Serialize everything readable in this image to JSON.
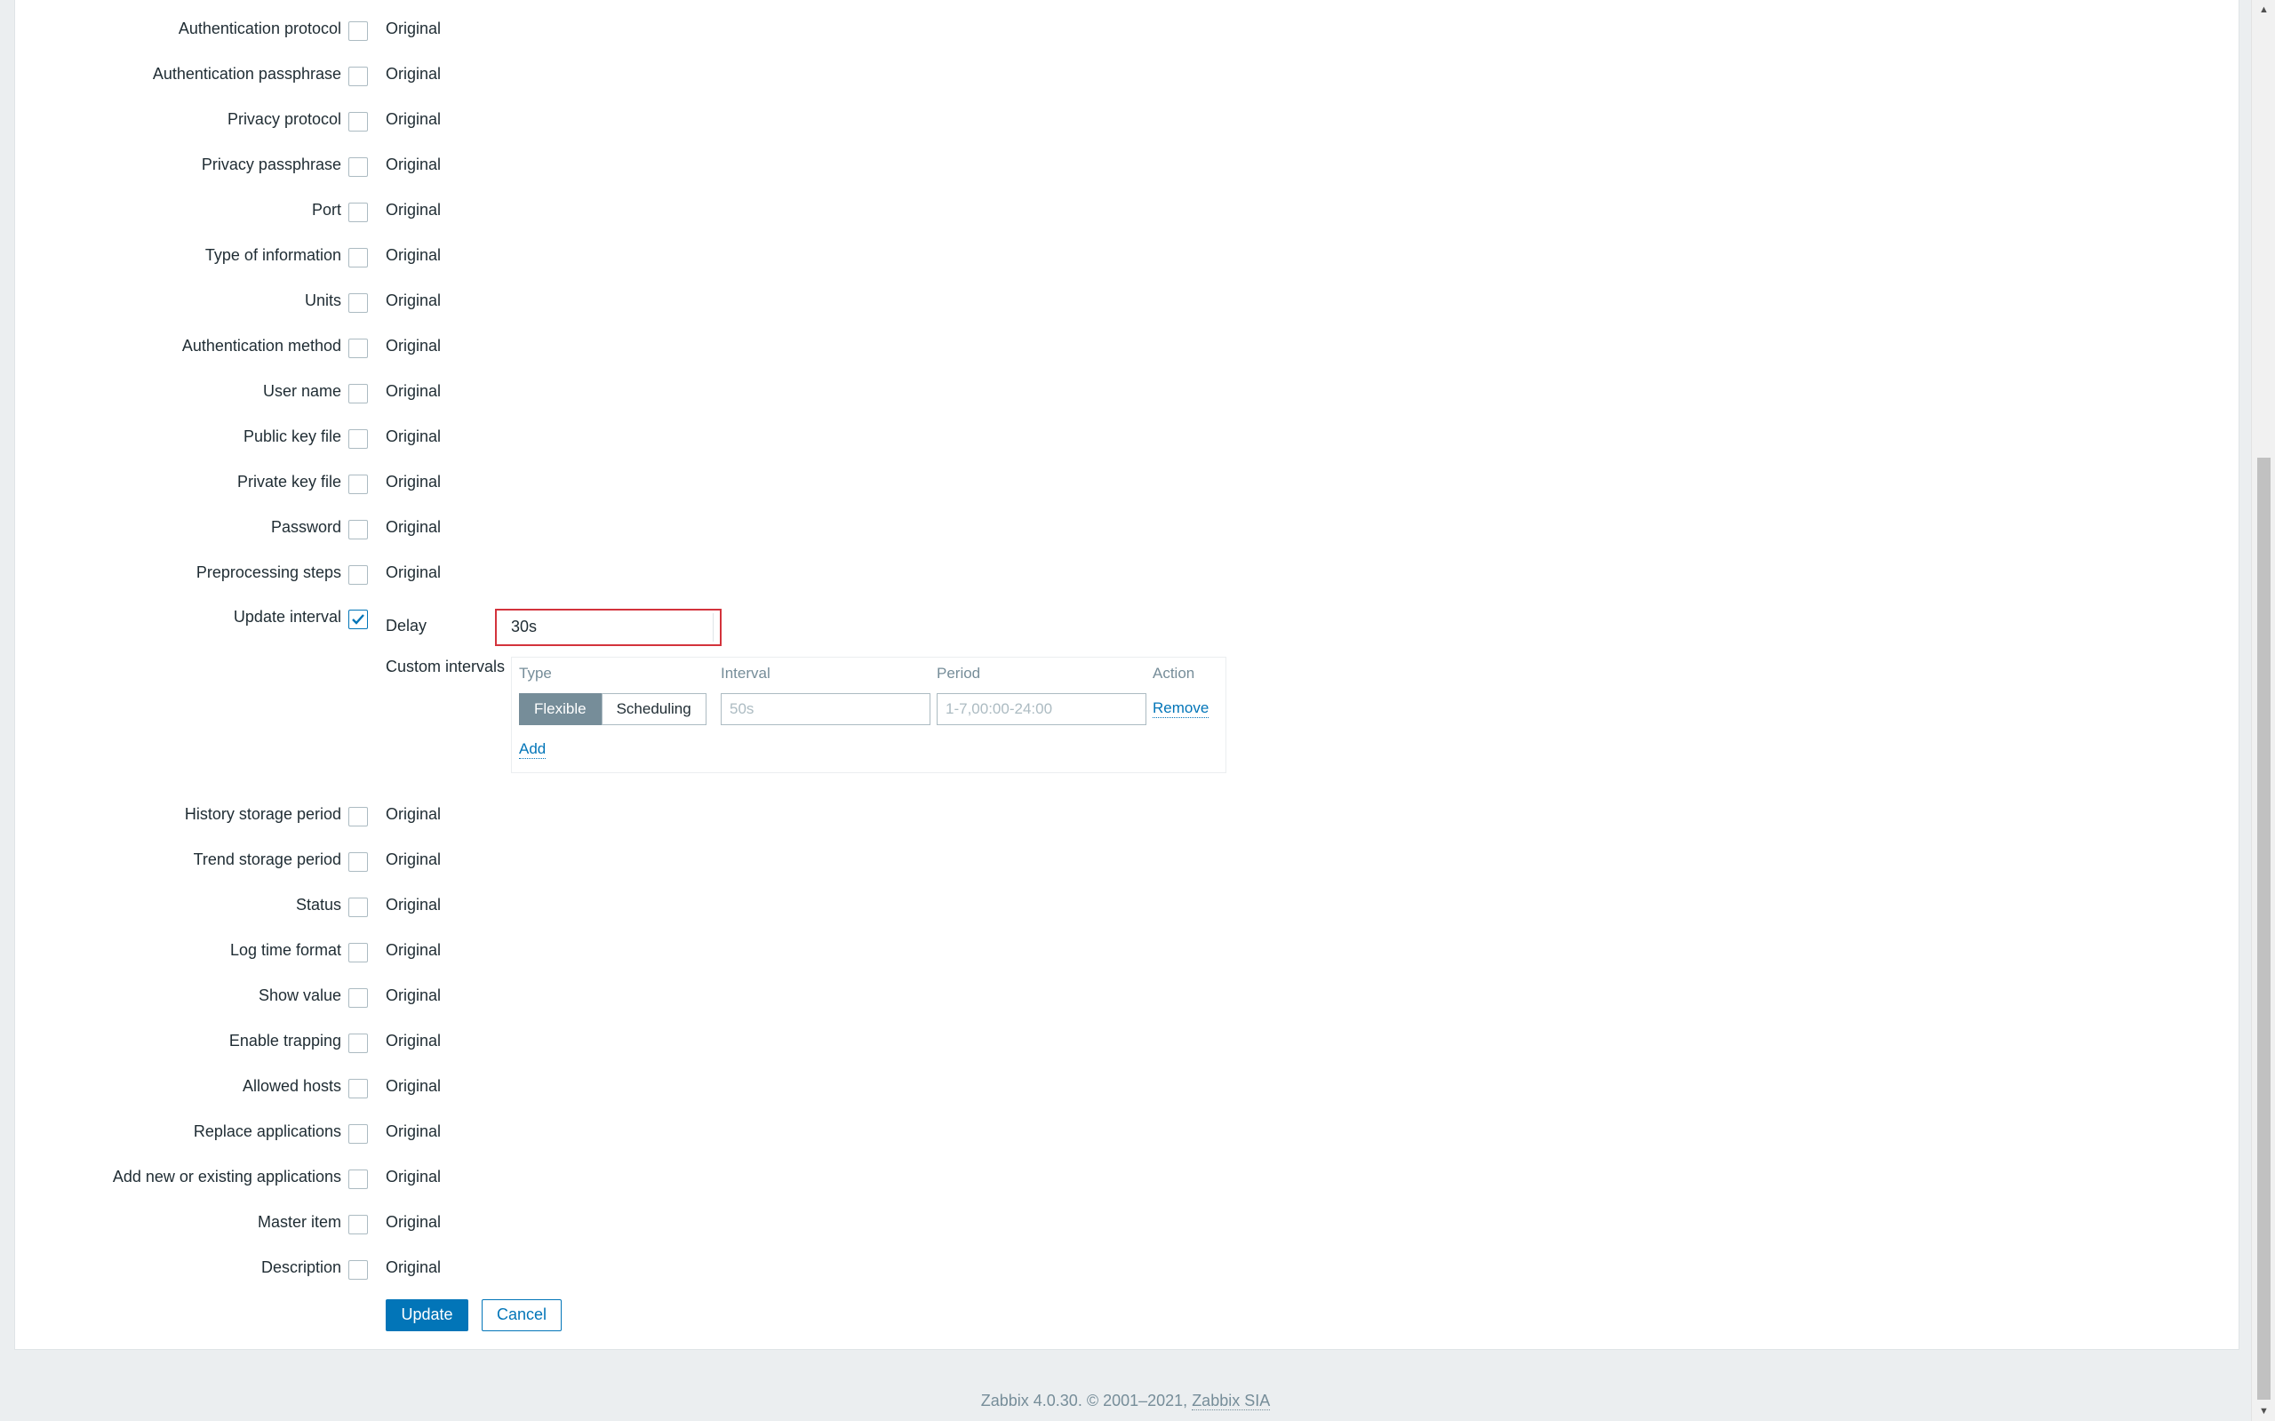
{
  "form": {
    "original_text": "Original",
    "rows_top": [
      {
        "label": "Authentication protocol"
      },
      {
        "label": "Authentication passphrase"
      },
      {
        "label": "Privacy protocol"
      },
      {
        "label": "Privacy passphrase"
      },
      {
        "label": "Port"
      },
      {
        "label": "Type of information"
      },
      {
        "label": "Units"
      },
      {
        "label": "Authentication method"
      },
      {
        "label": "User name"
      },
      {
        "label": "Public key file"
      },
      {
        "label": "Private key file"
      },
      {
        "label": "Password"
      },
      {
        "label": "Preprocessing steps"
      }
    ],
    "update_interval": {
      "label": "Update interval",
      "checked": true,
      "delay_label": "Delay",
      "delay_value": "30s",
      "custom_intervals_label": "Custom intervals",
      "headers": {
        "type": "Type",
        "interval": "Interval",
        "period": "Period",
        "action": "Action"
      },
      "row": {
        "type_options": [
          "Flexible",
          "Scheduling"
        ],
        "type_selected": "Flexible",
        "interval_placeholder": "50s",
        "period_placeholder": "1-7,00:00-24:00",
        "remove_label": "Remove"
      },
      "add_label": "Add"
    },
    "rows_bottom": [
      {
        "label": "History storage period"
      },
      {
        "label": "Trend storage period"
      },
      {
        "label": "Status"
      },
      {
        "label": "Log time format"
      },
      {
        "label": "Show value"
      },
      {
        "label": "Enable trapping"
      },
      {
        "label": "Allowed hosts"
      },
      {
        "label": "Replace applications"
      },
      {
        "label": "Add new or existing applications"
      },
      {
        "label": "Master item"
      },
      {
        "label": "Description"
      }
    ],
    "buttons": {
      "update": "Update",
      "cancel": "Cancel"
    }
  },
  "footer": {
    "text": "Zabbix 4.0.30. © 2001–2021, ",
    "link": "Zabbix SIA"
  },
  "colors": {
    "accent": "#0275b8",
    "highlight_border": "#d3333c",
    "segment_active": "#768d99"
  }
}
